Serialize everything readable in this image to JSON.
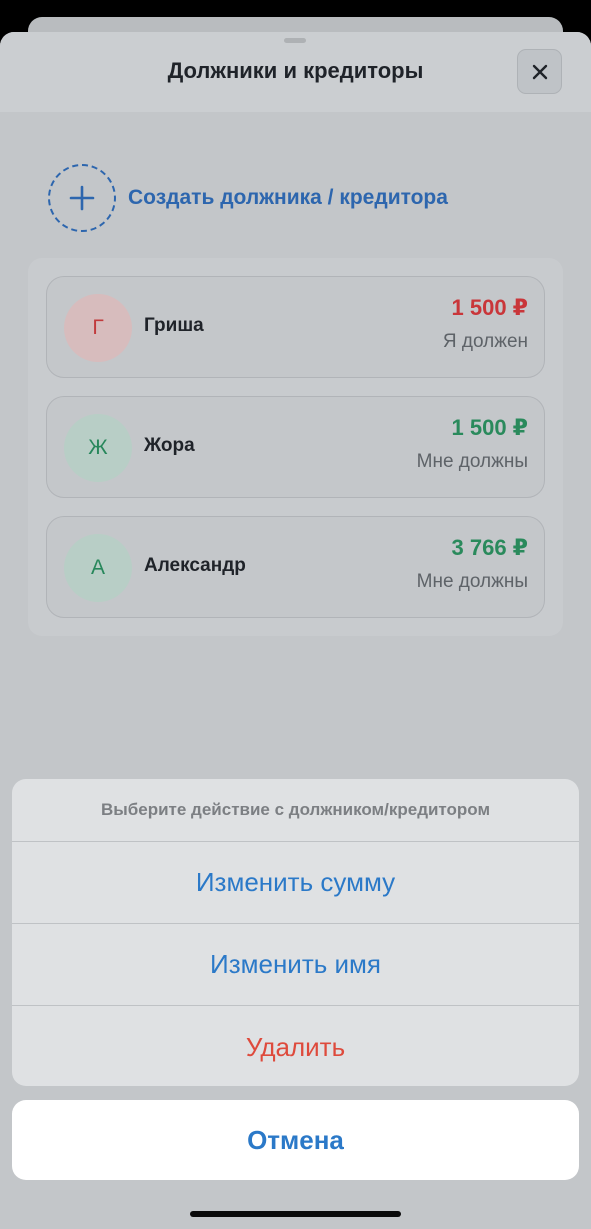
{
  "sheet": {
    "title": "Должники и кредиторы",
    "close_icon": "close-icon"
  },
  "create": {
    "label": "Создать должника / кредитора",
    "icon": "plus-icon"
  },
  "people": [
    {
      "initial": "Г",
      "name": "Гриша",
      "amount": "1 500 ₽",
      "status": "Я должен",
      "color": "#c9363a"
    },
    {
      "initial": "Ж",
      "name": "Жора",
      "amount": "1 500 ₽",
      "status": "Мне должны",
      "color": "#2a8a5c"
    },
    {
      "initial": "А",
      "name": "Александр",
      "amount": "3 766 ₽",
      "status": "Мне должны",
      "color": "#2a8a5c"
    }
  ],
  "action_sheet": {
    "title": "Выберите действие с должником/кредитором",
    "items": [
      {
        "label": "Изменить сумму"
      },
      {
        "label": "Изменить имя"
      },
      {
        "label": "Удалить"
      }
    ],
    "cancel": "Отмена"
  },
  "colors": {
    "accent": "#2b79c8",
    "destructive": "#de4a3c",
    "debt": "#c9363a",
    "credit": "#2a8a5c"
  }
}
